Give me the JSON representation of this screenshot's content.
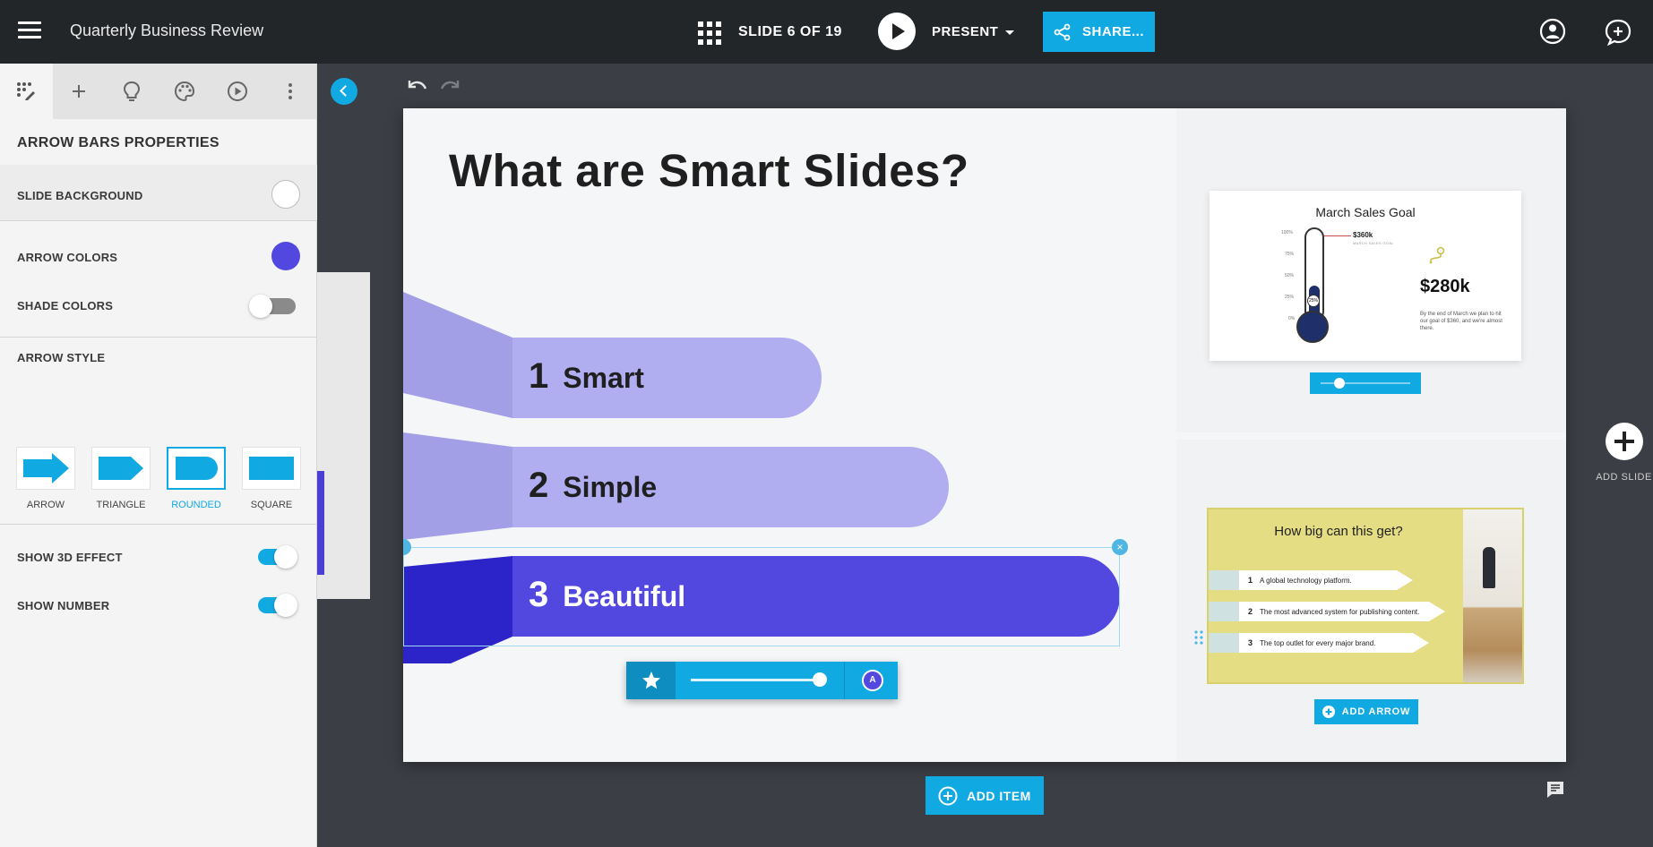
{
  "header": {
    "doc_title": "Quarterly Business Review",
    "slide_counter": "SLIDE 6 OF 19",
    "present_label": "PRESENT",
    "share_label": "SHARE..."
  },
  "panel": {
    "tabs": [
      "layout-icon",
      "add-icon",
      "lightbulb-icon",
      "palette-icon",
      "play-icon",
      "more-icon"
    ],
    "title": "ARROW BARS PROPERTIES",
    "slide_background_label": "SLIDE BACKGROUND",
    "arrow_colors_label": "ARROW COLORS",
    "arrow_color": "#5248e0",
    "shade_colors_label": "SHADE COLORS",
    "shade_colors_on": false,
    "arrow_style_label": "ARROW STYLE",
    "styles": [
      "ARROW",
      "TRIANGLE",
      "ROUNDED",
      "SQUARE"
    ],
    "selected_style": "ROUNDED",
    "show_3d_label": "SHOW 3D EFFECT",
    "show_3d_on": true,
    "show_number_label": "SHOW NUMBER",
    "show_number_on": true
  },
  "slide": {
    "title": "What are Smart Slides?",
    "arrows": [
      {
        "num": "1",
        "label": "Smart",
        "color": "#b0aef0"
      },
      {
        "num": "2",
        "label": "Simple",
        "color": "#b0aef0"
      },
      {
        "num": "3",
        "label": "Beautiful",
        "color": "#5248e0"
      }
    ],
    "toolbar": {
      "a_label": "A"
    }
  },
  "suggestions": {
    "card1": {
      "title": "March Sales Goal",
      "ticks": [
        "100%",
        "75%",
        "50%",
        "25%",
        "0%"
      ],
      "goal_value": "$360k",
      "goal_sub": "MARCH SALES GOAL",
      "percent": "25%",
      "big_value": "$280k",
      "text": "By the end of March we plan to hit our goal of $360, and we're almost there."
    },
    "card2": {
      "title": "How big can this get?",
      "items": [
        {
          "num": "1",
          "text": "A global technology platform."
        },
        {
          "num": "2",
          "text": "The most advanced system for publishing content."
        },
        {
          "num": "3",
          "text": "The top outlet for every major brand."
        }
      ]
    },
    "add_arrow_label": "ADD ARROW"
  },
  "footer": {
    "add_item_label": "ADD ITEM",
    "add_slide_label": "ADD SLIDE"
  }
}
